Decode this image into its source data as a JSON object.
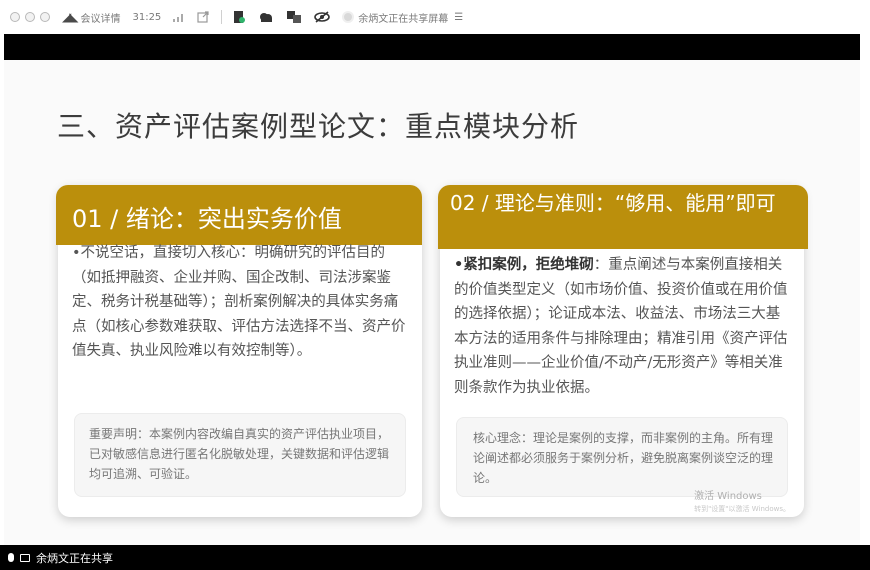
{
  "toolbar": {
    "meeting_label": "会议详情",
    "timer": "31:25",
    "sharing_status": "余炳文正在共享屏幕"
  },
  "slide": {
    "title": "三、资产评估案例型论文：重点模块分析",
    "cards": [
      {
        "header": "01 / 绪论：突出实务价值",
        "body": "•不说空话，直接切入核心：明确研究的评估目的（如抵押融资、企业并购、国企改制、司法涉案鉴定、税务计税基础等）；剖析案例解决的具体实务痛点（如核心参数难获取、评估方法选择不当、资产价值失真、执业风险难以有效控制等）。",
        "note": "重要声明：本案例内容改编自真实的资产评估执业项目，已对敏感信息进行匿名化脱敏处理，关键数据和评估逻辑均可追溯、可验证。"
      },
      {
        "header": "02 / 理论与准则：“够用、能用”即可",
        "body_bold": "•紧扣案例，拒绝堆砌",
        "body": "：重点阐述与本案例直接相关的价值类型定义（如市场价值、投资价值或在用价值的选择依据）；论证成本法、收益法、市场法三大基本方法的适用条件与排除理由；精准引用《资产评估执业准则——企业价值/不动产/无形资产》等相关准则条款作为执业依据。",
        "note": "核心理念：理论是案例的支撑，而非案例的主角。所有理论阐述都必须服务于案例分析，避免脱离案例谈空泛的理论。"
      }
    ],
    "watermark": "激活 Windows",
    "watermark_sub": "转到\"设置\"以激活 Windows。"
  },
  "status_bar": {
    "sharing_label": "余炳文正在共享"
  },
  "colors": {
    "header_gold": "#bb8f0c",
    "band": "#000000"
  }
}
